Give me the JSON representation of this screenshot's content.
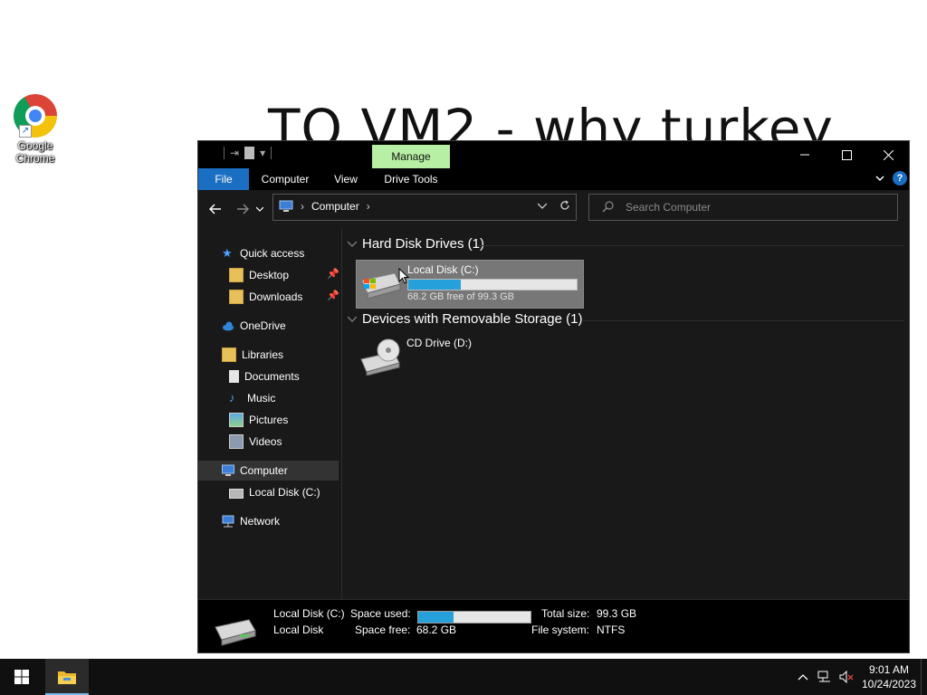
{
  "desktop": {
    "icons": [
      {
        "label": "Google Chrome",
        "icon": "chrome-icon"
      }
    ],
    "background_text": "TO VM2 - why turkey"
  },
  "window": {
    "contextual_tab": "Manage",
    "ribbon_tabs": [
      "File",
      "Computer",
      "View",
      "Drive Tools"
    ],
    "controls": {
      "minimize": "─",
      "maximize": "☐",
      "close": "✕"
    },
    "help": "?",
    "address": {
      "root_icon": "computer-icon",
      "path": [
        "Computer"
      ]
    },
    "search_placeholder": "Search Computer",
    "nav": {
      "quick_access": "Quick access",
      "desktop": "Desktop",
      "downloads": "Downloads",
      "onedrive": "OneDrive",
      "libraries": "Libraries",
      "documents": "Documents",
      "music": "Music",
      "pictures": "Pictures",
      "videos": "Videos",
      "computer": "Computer",
      "local_disk": "Local Disk (C:)",
      "network": "Network"
    },
    "groups": {
      "hard_disks": {
        "title": "Hard Disk Drives (1)",
        "drives": [
          {
            "name": "Local Disk (C:)",
            "free_text": "68.2 GB free of 99.3 GB",
            "used_fraction": 0.313
          }
        ]
      },
      "removable": {
        "title": "Devices with Removable Storage (1)",
        "drives": [
          {
            "name": "CD Drive (D:)"
          }
        ]
      }
    },
    "details": {
      "name": "Local Disk (C:)",
      "type": "Local Disk",
      "space_used_label": "Space used:",
      "space_free_label": "Space free:",
      "space_free_value": "68.2 GB",
      "total_size_label": "Total size:",
      "total_size_value": "99.3 GB",
      "file_system_label": "File system:",
      "file_system_value": "NTFS",
      "used_fraction": 0.313
    }
  },
  "taskbar": {
    "time": "9:01 AM",
    "date": "10/24/2023"
  },
  "colors": {
    "accent": "#1a6fc2",
    "manage_tab": "#b7f0a4",
    "bar_fill": "#26a0da",
    "window_bg": "#191919"
  }
}
